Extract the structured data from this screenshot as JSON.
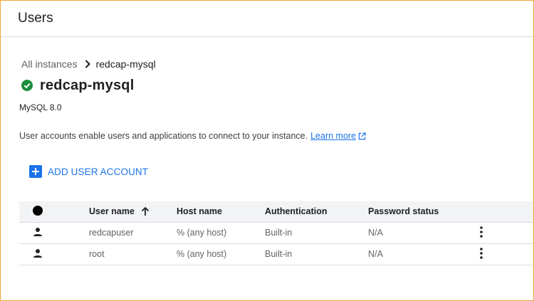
{
  "header": {
    "title": "Users"
  },
  "breadcrumb": {
    "parent": "All instances",
    "current": "redcap-mysql"
  },
  "instance": {
    "name": "redcap-mysql",
    "status_color": "#1e8e3e",
    "version": "MySQL 8.0"
  },
  "description": {
    "text": "User accounts enable users and applications to connect to your instance.",
    "learn_more": "Learn more"
  },
  "add_button": {
    "label": "ADD USER ACCOUNT"
  },
  "table": {
    "columns": {
      "user_name": "User name",
      "host_name": "Host name",
      "authentication": "Authentication",
      "password_status": "Password status"
    },
    "sort": {
      "column": "User name",
      "direction": "ascending"
    },
    "rows": [
      {
        "user_name": "redcapuser",
        "host_name": "% (any host)",
        "authentication": "Built-in",
        "password_status": "N/A"
      },
      {
        "user_name": "root",
        "host_name": "% (any host)",
        "authentication": "Built-in",
        "password_status": "N/A"
      }
    ]
  },
  "colors": {
    "accent": "#1a73e8",
    "border": "#f0a63a"
  }
}
